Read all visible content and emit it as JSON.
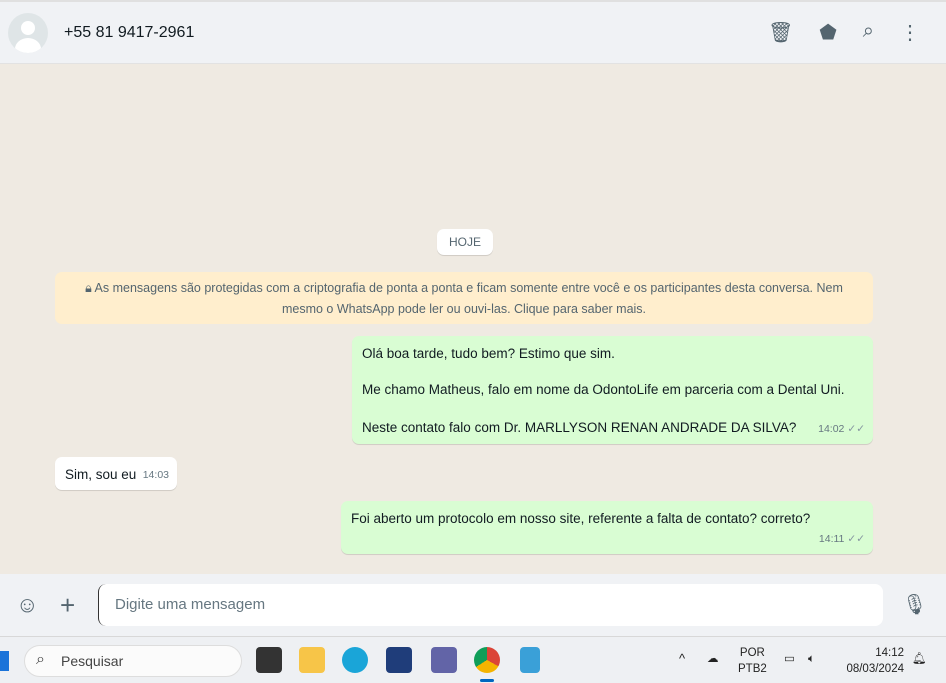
{
  "header": {
    "contact": "+55 81 9417-2961",
    "icons": [
      "delete-icon",
      "label-icon",
      "search-icon",
      "menu-icon"
    ]
  },
  "chat": {
    "date_chip": "HOJE",
    "encryption_notice": "As mensagens são protegidas com a criptografia de ponta a ponta e ficam somente entre você e os participantes desta conversa. Nem mesmo o WhatsApp pode ler ou ouvi-las. Clique para saber mais.",
    "messages": [
      {
        "dir": "out",
        "lines": [
          "Olá boa tarde, tudo bem? Estimo que sim.",
          "Me chamo Matheus, falo em nome da OdontoLife em parceria com a Dental Uni.",
          "Neste contato falo com Dr. MARLLYSON RENAN ANDRADE DA SILVA?"
        ],
        "time": "14:02"
      },
      {
        "dir": "in",
        "text": "Sim, sou eu",
        "time": "14:03"
      },
      {
        "dir": "out",
        "text": "Foi aberto um protocolo em nosso site, referente a falta de contato? correto?",
        "time": "14:11"
      }
    ]
  },
  "composer": {
    "placeholder": "Digite uma mensagem"
  },
  "taskbar": {
    "search": "Pesquisar",
    "lang1": "POR",
    "lang2": "PTB2",
    "time": "14:12",
    "date": "08/03/2024"
  }
}
